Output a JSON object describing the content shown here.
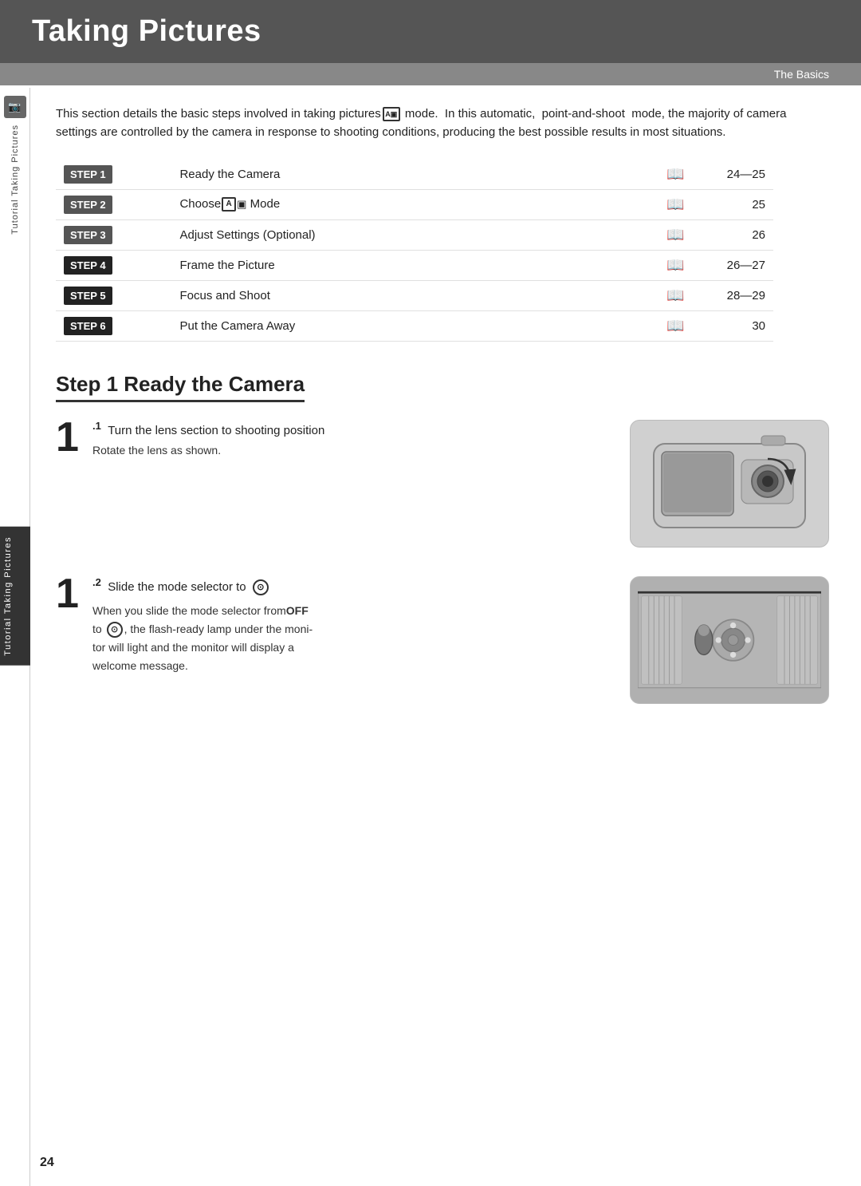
{
  "header": {
    "title": "Taking Pictures",
    "subtitle": "The Basics"
  },
  "sidebar": {
    "icon_label": "📷",
    "vertical_text": "Tutorial Taking Pictures"
  },
  "intro": {
    "text": "This section details the basic steps involved in taking pictures  mode.  In this automatic,  point-and-shoot  mode, the majority of camera settings are controlled by the camera in response to shooting conditions, producing the best possible results in most situations."
  },
  "steps_table": [
    {
      "badge": "STEP 1",
      "dark": false,
      "label": "Ready the Camera",
      "icon": "📖",
      "pages": "24—25"
    },
    {
      "badge": "STEP 2",
      "dark": false,
      "label": "Choose  Mode",
      "icon": "📖",
      "pages": "25"
    },
    {
      "badge": "STEP 3",
      "dark": false,
      "label": "Adjust Settings (Optional)",
      "icon": "📖",
      "pages": "26"
    },
    {
      "badge": "STEP 4",
      "dark": true,
      "label": "Frame the Picture",
      "icon": "📖",
      "pages": "26—27"
    },
    {
      "badge": "STEP 5",
      "dark": true,
      "label": "Focus and Shoot",
      "icon": "📖",
      "pages": "28—29"
    },
    {
      "badge": "STEP 6",
      "dark": true,
      "label": "Put the Camera Away",
      "icon": "📖",
      "pages": "30"
    }
  ],
  "section1": {
    "heading": "Step 1 Ready the Camera",
    "sub1": {
      "number": "1",
      "decimal": ".1",
      "title": "Turn the lens section to shooting position",
      "desc": "Rotate the lens as shown.",
      "img_alt": "Camera lens rotation diagram"
    },
    "sub2": {
      "number": "1",
      "decimal": ".2",
      "title": "Slide the mode selector to",
      "desc_line1": "When you slide the mode selector from OFF",
      "desc_line2": "to  , the flash-ready lamp under the moni-",
      "desc_line3": "tor will light and the monitor will display a",
      "desc_line4": "welcome message.",
      "img_alt": "Mode selector diagram"
    }
  },
  "footer": {
    "page_number": "24"
  }
}
